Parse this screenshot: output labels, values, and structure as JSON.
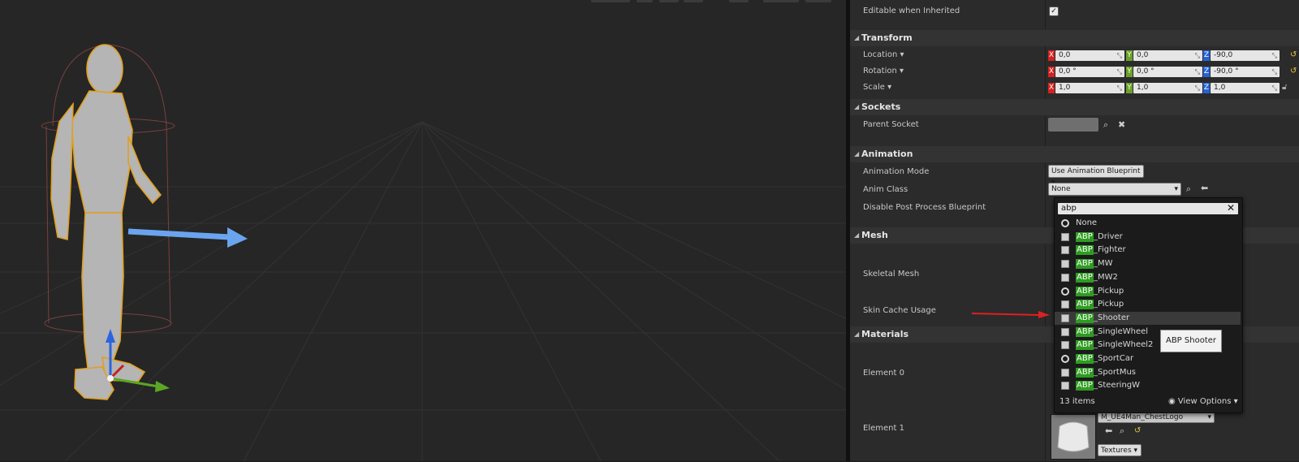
{
  "details": {
    "editable_when_inherited": {
      "label": "Editable when Inherited",
      "checked": true,
      "check_glyph": "✓"
    },
    "categories": {
      "transform": "Transform",
      "sockets": "Sockets",
      "animation": "Animation",
      "mesh": "Mesh",
      "materials": "Materials"
    },
    "transform": {
      "location": {
        "label": "Location",
        "x": "0,0",
        "y": "0,0",
        "z": "-90,0"
      },
      "rotation": {
        "label": "Rotation",
        "x": "0,0 °",
        "y": "0,0 °",
        "z": "-90,0 °"
      },
      "scale": {
        "label": "Scale",
        "x": "1,0",
        "y": "1,0",
        "z": "1,0"
      },
      "axis_x": "X",
      "axis_y": "Y",
      "axis_z": "Z"
    },
    "sockets": {
      "parent_socket": "Parent Socket"
    },
    "animation": {
      "animation_mode_label": "Animation Mode",
      "animation_mode_value": "Use Animation Blueprint",
      "anim_class_label": "Anim Class",
      "anim_class_value": "None",
      "disable_post_process_label": "Disable Post Process Blueprint"
    },
    "mesh": {
      "skeletal_mesh": "Skeletal Mesh",
      "skin_cache_usage": "Skin Cache Usage"
    },
    "materials": {
      "element0": "Element 0",
      "element1": "Element 1",
      "element1_material": "M_UE4Man_ChestLogo",
      "textures_button": "Textures"
    }
  },
  "popup": {
    "search_value": "abp",
    "items": [
      {
        "highlight": "",
        "rest": "None",
        "icon": "circle"
      },
      {
        "highlight": "ABP",
        "rest": "_Driver",
        "icon": "doc"
      },
      {
        "highlight": "ABP",
        "rest": "_Fighter",
        "icon": "doc"
      },
      {
        "highlight": "ABP",
        "rest": "_MW",
        "icon": "doc"
      },
      {
        "highlight": "ABP",
        "rest": "_MW2",
        "icon": "doc"
      },
      {
        "highlight": "ABP",
        "rest": "_Pickup",
        "icon": "circle"
      },
      {
        "highlight": "ABP",
        "rest": "_Pickup",
        "icon": "doc"
      },
      {
        "highlight": "ABP",
        "rest": "_Shooter",
        "icon": "doc"
      },
      {
        "highlight": "ABP",
        "rest": "_SingleWheel",
        "icon": "doc"
      },
      {
        "highlight": "ABP",
        "rest": "_SingleWheel2",
        "icon": "doc"
      },
      {
        "highlight": "ABP",
        "rest": "_SportCar",
        "icon": "circle"
      },
      {
        "highlight": "ABP",
        "rest": "_SportMus",
        "icon": "doc"
      },
      {
        "highlight": "ABP",
        "rest": "_SteeringW",
        "icon": "doc"
      }
    ],
    "item_count": "13 items",
    "view_options": "View Options",
    "tooltip": "ABP Shooter"
  },
  "colors": {
    "highlight": "#2e9c21",
    "axis_x": "#d6221f",
    "axis_y": "#6ba12b",
    "axis_z": "#2563d8",
    "reset_arrow": "#e7c73c",
    "annotation_arrow": "#e01f1f"
  }
}
